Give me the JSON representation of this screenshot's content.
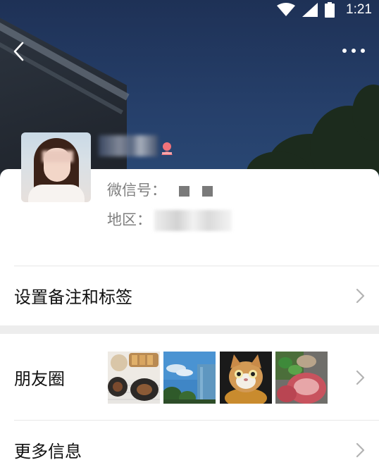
{
  "status_bar": {
    "time": "1:21"
  },
  "profile": {
    "wechat_id_label": "微信号：",
    "region_label": "地区："
  },
  "menu": {
    "remarks_tags_label": "设置备注和标签",
    "moments_label": "朋友圈",
    "more_info_label": "更多信息"
  },
  "moments_thumbnails": [
    "food-photo",
    "sky-trees-photo",
    "cat-photo",
    "meat-vegetables-photo"
  ],
  "colors": {
    "header_sky": "#26406b",
    "text_primary": "#111111",
    "text_secondary": "#7f7f7f",
    "gender_female": "#f0727a",
    "divider": "#e7e7e7"
  }
}
